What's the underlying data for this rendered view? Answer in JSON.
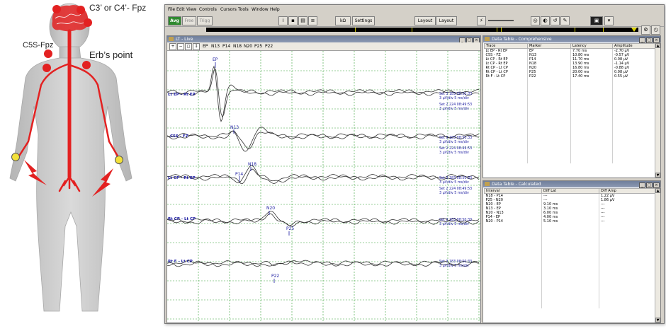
{
  "figure": {
    "labels": {
      "c3c4": "C3’ or C4’- Fpz",
      "c5s": "C5S-Fpz",
      "erb": "Erb’s point"
    },
    "colors": {
      "electrode": "#e32121",
      "stim": "#f3e13a",
      "nerve": "#e32121",
      "body": "#c9c9c9"
    }
  },
  "app": {
    "menu": [
      "File",
      "Edit",
      "View",
      "Controls",
      "Cursors",
      "Tools",
      "Window",
      "Help"
    ],
    "toolbar": {
      "avg": "Avg",
      "free": "Free",
      "trigg": "Trigg",
      "kohm": "kΩ",
      "settings": "Settings",
      "layout1": "Layout",
      "layout2": "Layout"
    },
    "live_window": {
      "title": "LT - Live",
      "markers": [
        "EP",
        "N13",
        "P14",
        "N18",
        "N20",
        "P25",
        "P22"
      ],
      "traces": [
        {
          "label": "Lt EP - Rt EP",
          "set1": "Set 3 183 08:50:33",
          "scale1": "3 µV/div 5 ms/div",
          "set2": "Set 2 224 08:49:53",
          "scale2": "3 µV/div 5 ms/div"
        },
        {
          "label": "C5S - FZ",
          "set1": "Set 3 183 08:50:33",
          "scale1": "3 µV/div 5 ms/div",
          "set2": "Set 2 224 08:49:53",
          "scale2": "3 µV/div 5 ms/div"
        },
        {
          "label": "Lt CP - Rt EP",
          "set1": "Set 3 183 08:50:33",
          "scale1": "3 µV/div 5 ms/div",
          "set2": "Set 2 224 08:49:53",
          "scale2": "3 µV/div 5 ms/div"
        },
        {
          "label": "Rt CP - Lt CP",
          "set1": "Set 3 183 08:50:33",
          "scale1": "3 µV/div 5 ms/div",
          "set2": "",
          "scale2": ""
        },
        {
          "label": "Rt F - Lt CP",
          "set1": "Set 3 183 08:50:33",
          "scale1": "3 µV/div 5 ms/div",
          "set2": "",
          "scale2": ""
        }
      ],
      "peak_labels": [
        "EP",
        "N13",
        "P14",
        "N18",
        "N20",
        "P25",
        "P22"
      ]
    },
    "comprehensive": {
      "title": "Data Table - Comprehensive",
      "columns": [
        "Trace",
        "Marker",
        "Latency",
        "Amplitude"
      ],
      "rows": [
        [
          "Lt EP - Rt EP",
          "EP",
          "7.70 ms",
          "-2.70 µV"
        ],
        [
          "C5S - FZ",
          "N13",
          "10.80 ms",
          "-0.57 µV"
        ],
        [
          "Lt CP - Rt EP",
          "P14",
          "11.70 ms",
          "0.08 µV"
        ],
        [
          "Lt CP - Rt EP",
          "N18",
          "13.90 ms",
          "-1.14 µV"
        ],
        [
          "Rt CP - Lt CP",
          "N20",
          "16.80 ms",
          "-0.88 µV"
        ],
        [
          "Rt CP - Lt CP",
          "P25",
          "20.00 ms",
          "0.98 µV"
        ],
        [
          "Rt F - Lt CP",
          "P22",
          "17.40 ms",
          "0.55 µV"
        ]
      ]
    },
    "calculated": {
      "title": "Data Table - Calculated",
      "columns": [
        "Interval",
        "Diff Lat",
        "Diff Amp"
      ],
      "rows": [
        [
          "N18 - P14",
          "---",
          "1.22 µV"
        ],
        [
          "P25 - N20",
          "---",
          "1.86 µV"
        ],
        [
          "N20 - EP",
          "9.10 ms",
          "---"
        ],
        [
          "N13 - EP",
          "3.10 ms",
          "---"
        ],
        [
          "N20 - N13",
          "6.00 ms",
          "---"
        ],
        [
          "P14 - EP",
          "4.00 ms",
          "---"
        ],
        [
          "N20 - P14",
          "5.10 ms",
          "---"
        ]
      ]
    }
  }
}
